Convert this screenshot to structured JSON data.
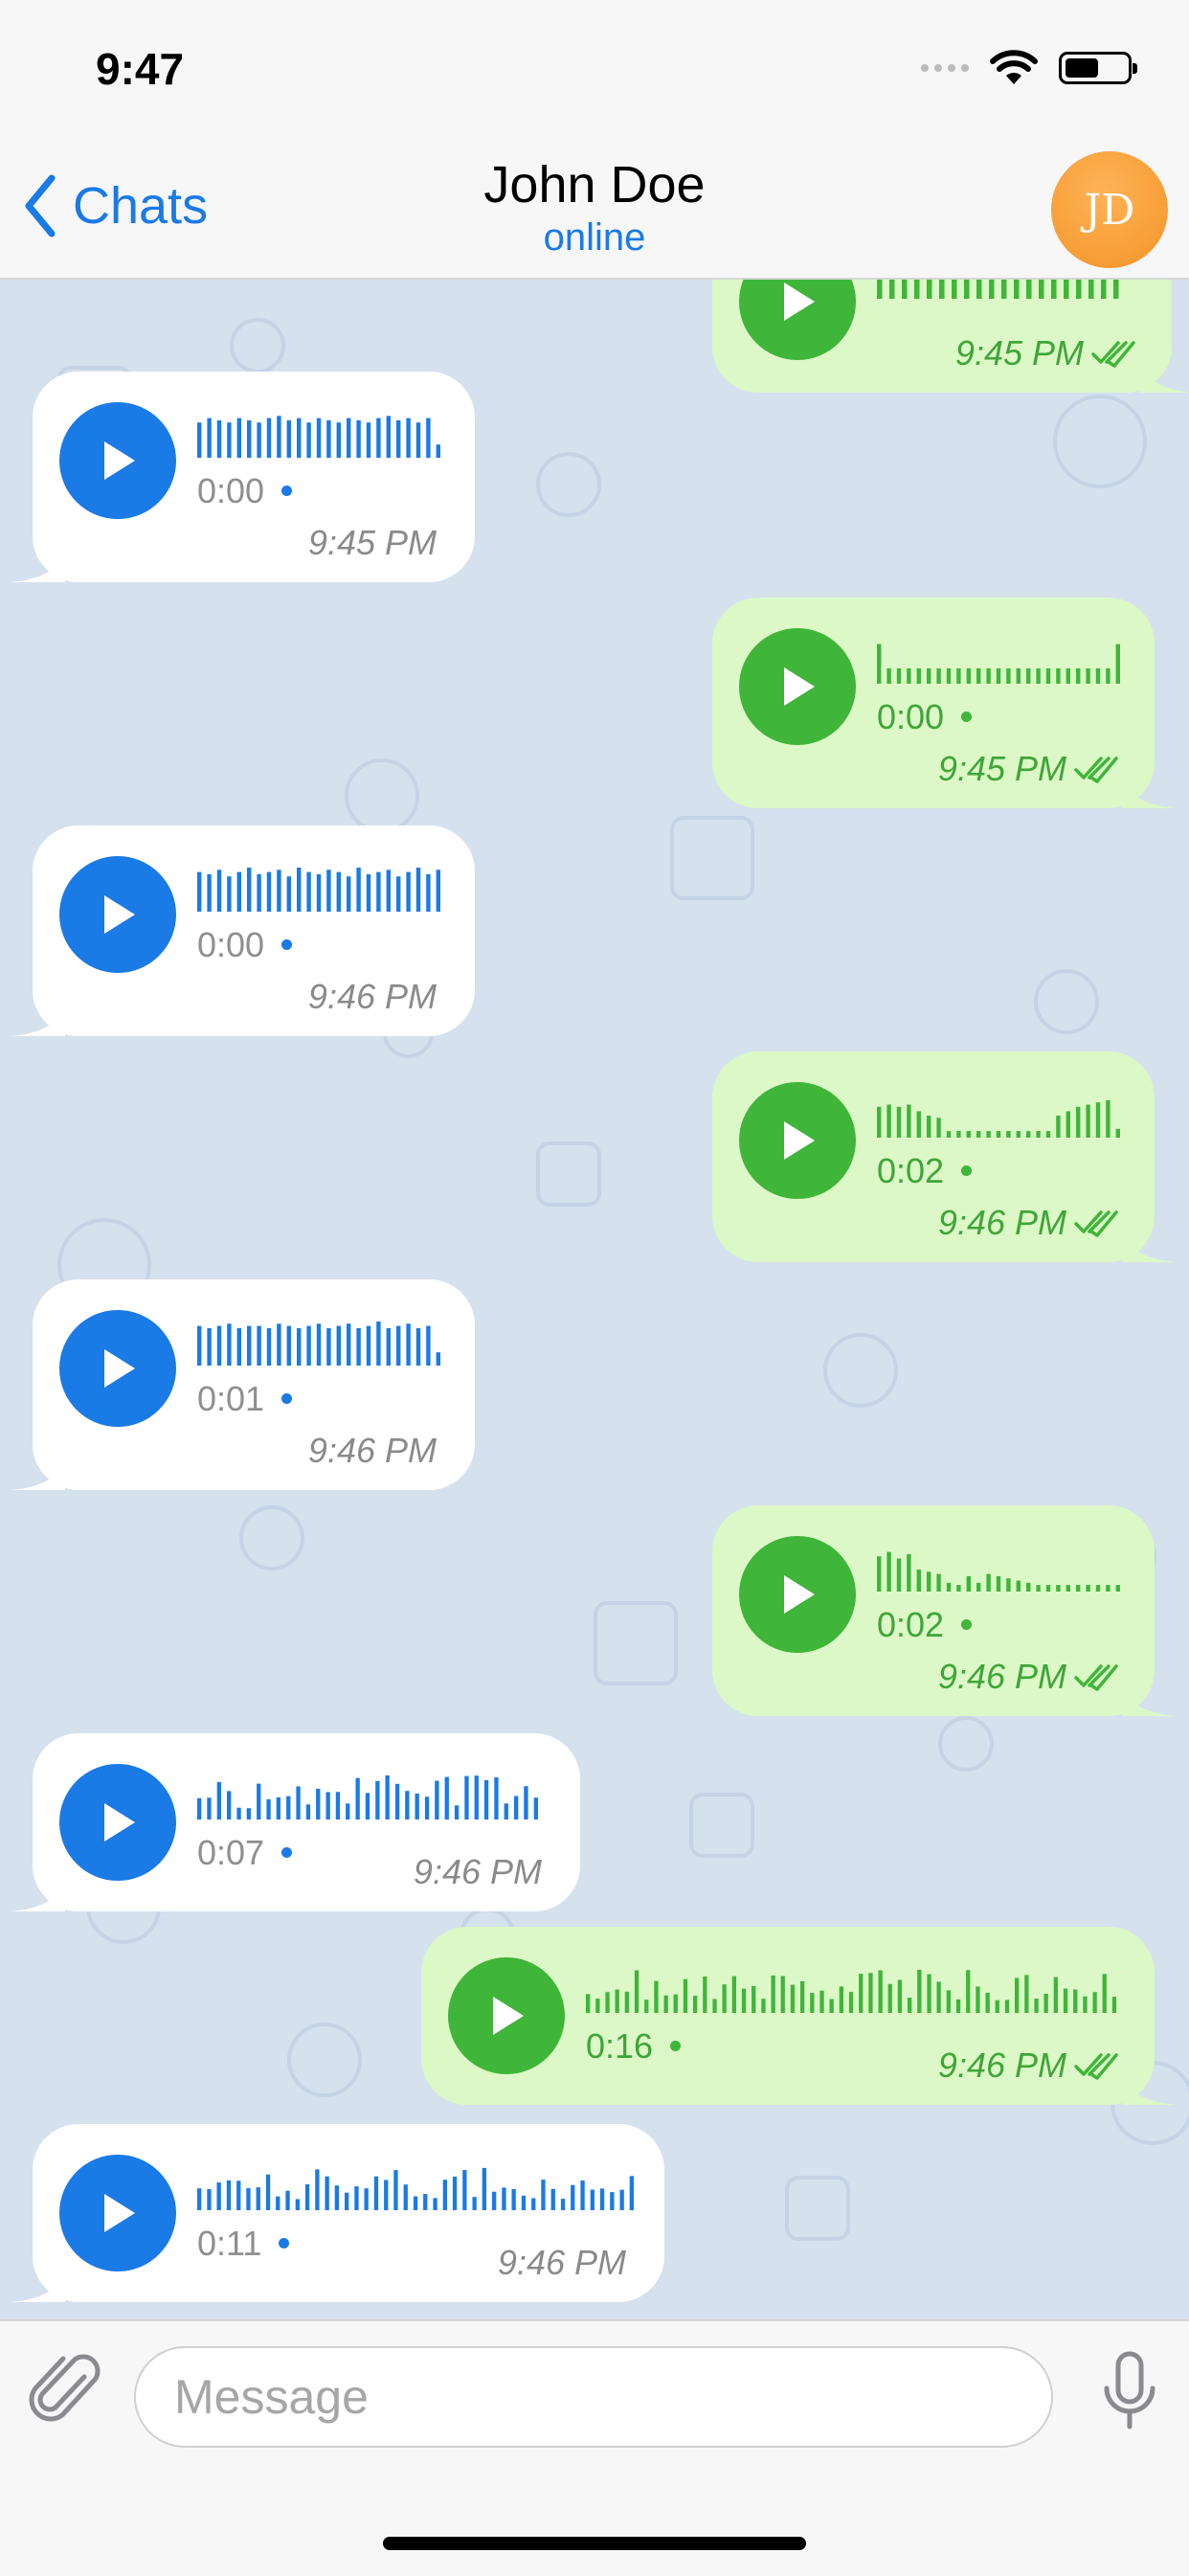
{
  "status_bar": {
    "time": "9:47",
    "battery_level": 0.55
  },
  "header": {
    "back_label": "Chats",
    "title": "John Doe",
    "subtitle": "online",
    "avatar_initials": "JD",
    "avatar_color": "#f7a33a"
  },
  "colors": {
    "accent_blue": "#1a7ae6",
    "incoming_bubble": "#ffffff",
    "outgoing_bubble": "#dcf8c6",
    "outgoing_accent": "#3fb53a",
    "chat_background": "#d6e1ee"
  },
  "messages": [
    {
      "direction": "out",
      "duration": "",
      "time": "9:45 PM",
      "read": true
    },
    {
      "direction": "in",
      "duration": "0:00",
      "time": "9:45 PM"
    },
    {
      "direction": "out",
      "duration": "0:00",
      "time": "9:45 PM",
      "read": true
    },
    {
      "direction": "in",
      "duration": "0:00",
      "time": "9:46 PM"
    },
    {
      "direction": "out",
      "duration": "0:02",
      "time": "9:46 PM",
      "read": true
    },
    {
      "direction": "in",
      "duration": "0:01",
      "time": "9:46 PM"
    },
    {
      "direction": "out",
      "duration": "0:02",
      "time": "9:46 PM",
      "read": true
    },
    {
      "direction": "in",
      "duration": "0:07",
      "time": "9:46 PM"
    },
    {
      "direction": "out",
      "duration": "0:16",
      "time": "9:46 PM",
      "read": true
    },
    {
      "direction": "in",
      "duration": "0:11",
      "time": "9:46 PM"
    }
  ],
  "input": {
    "placeholder": "Message"
  },
  "icons": {
    "back": "chevron-left-icon",
    "attach": "paperclip-icon",
    "mic": "microphone-icon",
    "play": "play-icon",
    "read_receipt": "double-check-icon"
  }
}
